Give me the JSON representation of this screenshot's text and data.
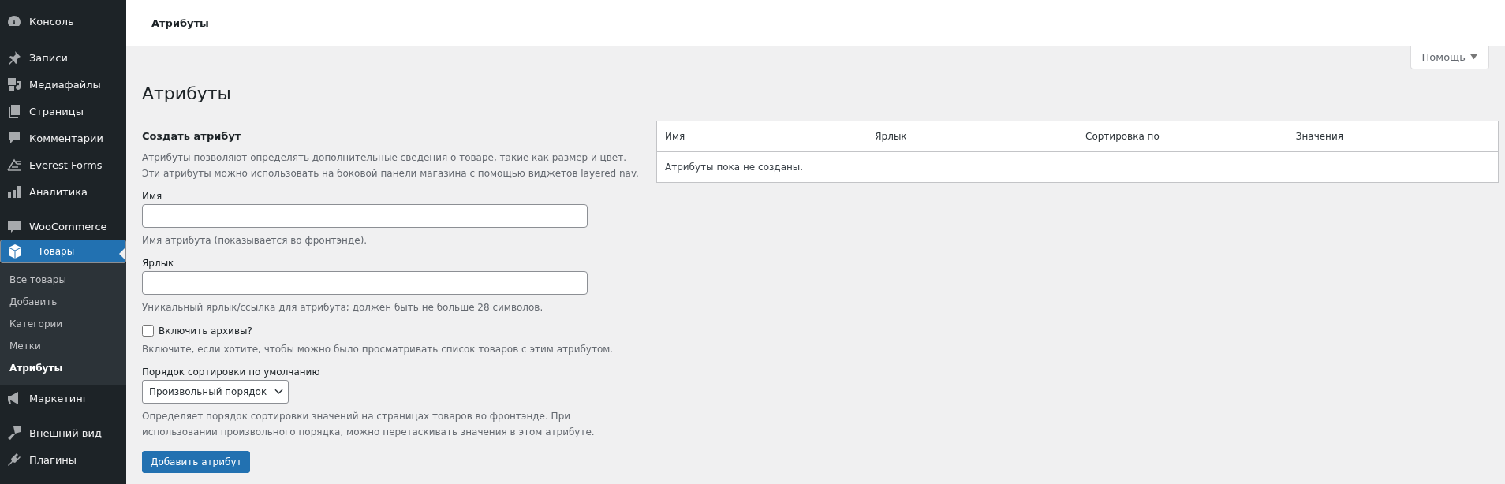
{
  "sidebar": {
    "groups": [
      [
        {
          "label": "Консоль",
          "selected": false
        }
      ],
      [
        {
          "label": "Записи",
          "selected": false
        },
        {
          "label": "Медиафайлы",
          "selected": false
        },
        {
          "label": "Страницы",
          "selected": false
        },
        {
          "label": "Комментарии",
          "selected": false
        },
        {
          "label": "Everest Forms",
          "selected": false
        },
        {
          "label": "Аналитика",
          "selected": false
        }
      ],
      [
        {
          "label": "WooCommerce",
          "selected": false
        },
        {
          "label": "Товары",
          "selected": true,
          "children": [
            {
              "label": "Все товары",
              "selected": false
            },
            {
              "label": "Добавить",
              "selected": false
            },
            {
              "label": "Категории",
              "selected": false
            },
            {
              "label": "Метки",
              "selected": false
            },
            {
              "label": "Атрибуты",
              "selected": true
            }
          ]
        },
        {
          "label": "Маркетинг",
          "selected": false
        }
      ],
      [
        {
          "label": "Внешний вид",
          "selected": false
        },
        {
          "label": "Плагины",
          "selected": false
        }
      ]
    ]
  },
  "top_bar": {
    "title": "Атрибуты"
  },
  "help_button": {
    "label": "Помощь"
  },
  "heading": "Атрибуты",
  "form": {
    "title": "Создать атрибут",
    "description": "Атрибуты позволяют определять дополнительные сведения о товаре, такие как размер и цвет. Эти атрибуты можно использовать на боковой панели магазина с помощью виджетов layered nav.",
    "fields": [
      {
        "kind": "text",
        "label": "Имя",
        "hint": "Имя атрибута (показывается во фронтэнде)."
      },
      {
        "kind": "text",
        "label": "Ярлык",
        "hint": "Уникальный ярлык/ссылка для атрибута; должен быть не больше 28 символов."
      },
      {
        "kind": "checkbox",
        "label": "Включить архивы?",
        "checked": false,
        "hint": "Включите, если хотите, чтобы можно было просматривать список товаров с этим атрибутом."
      },
      {
        "kind": "select",
        "label": "Порядок сортировки по умолчанию",
        "value": "Произвольный порядок",
        "hint": "Определяет порядок сортировки значений на страницах товаров во фронтэнде. При использовании произвольного порядка, можно перетаскивать значения в этом атрибуте."
      }
    ],
    "submit": "Добавить атрибут"
  },
  "table": {
    "columns": [
      "Имя",
      "Ярлык",
      "Сортировка по",
      "Значения"
    ],
    "empty_message": "Атрибуты пока не созданы."
  }
}
